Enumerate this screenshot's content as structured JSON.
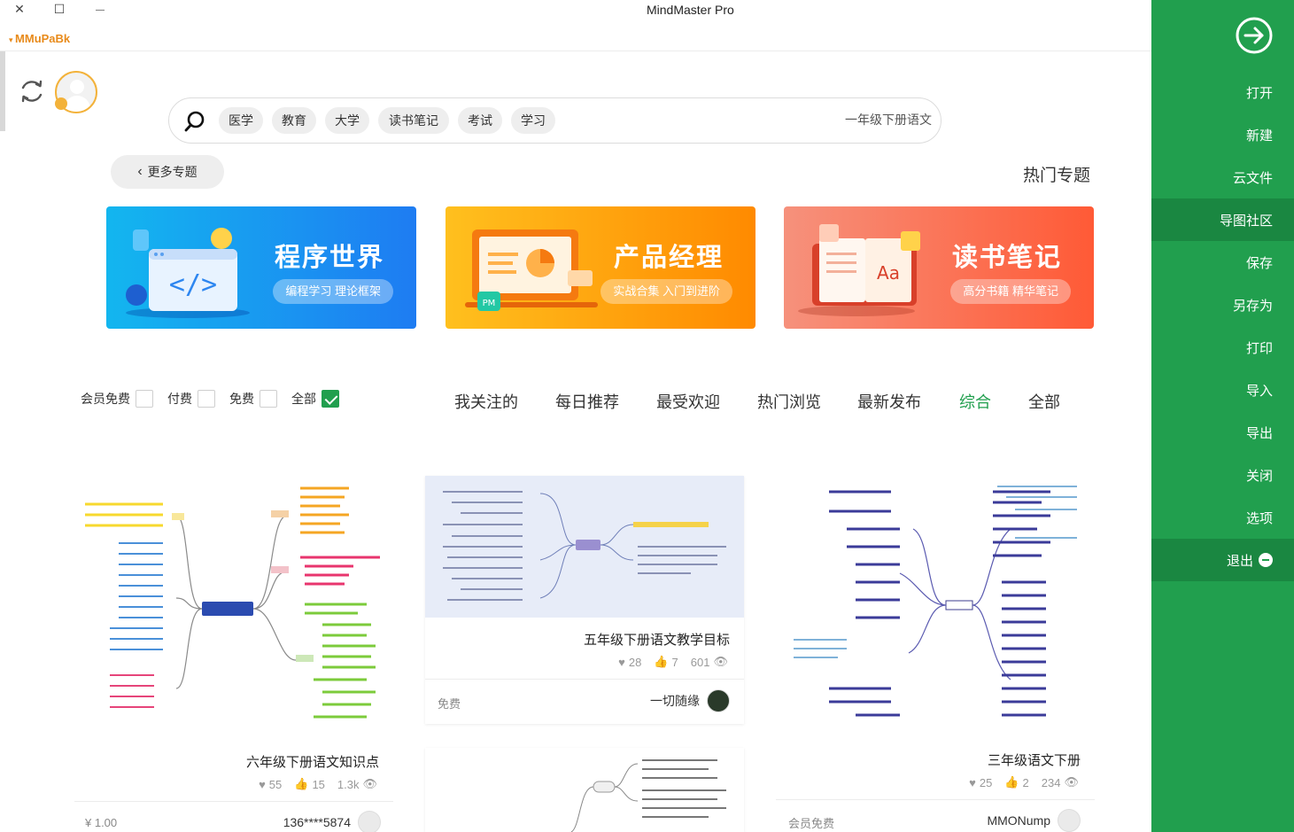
{
  "app": {
    "title": "MindMaster Pro",
    "account": "MMuPaBk",
    "window_controls": {
      "close": "✕",
      "maximize": "☐",
      "minimize": "—"
    }
  },
  "sidebar": {
    "items": [
      {
        "label": "打开"
      },
      {
        "label": "新建"
      },
      {
        "label": "云文件"
      },
      {
        "label": "导图社区"
      },
      {
        "label": "保存"
      },
      {
        "label": "另存为"
      },
      {
        "label": "打印"
      },
      {
        "label": "导入"
      },
      {
        "label": "导出"
      },
      {
        "label": "关闭"
      },
      {
        "label": "选项"
      },
      {
        "label": "退出"
      }
    ],
    "active_item": "导图社区",
    "colors": {
      "background": "#219f4e",
      "active": "#1a8741"
    }
  },
  "search": {
    "value": "一年级下册语文",
    "tags": [
      "学习",
      "考试",
      "读书笔记",
      "大学",
      "教育",
      "医学"
    ]
  },
  "topics": {
    "title": "热门专题",
    "more_button": "更多专题",
    "banners": [
      {
        "title": "读书笔记",
        "subtitle": "高分书籍 精华笔记",
        "color_from": "#ff5a36",
        "color_to": "#f6917c"
      },
      {
        "title": "产品经理",
        "subtitle": "实战合集 入门到进阶",
        "color_from": "#ff8a00",
        "color_to": "#ffc01e"
      },
      {
        "title": "程序世界",
        "subtitle": "编程学习 理论框架",
        "color_from": "#1e7cf2",
        "color_to": "#13b6ef"
      }
    ]
  },
  "tabs": [
    "全部",
    "综合",
    "最新发布",
    "热门浏览",
    "最受欢迎",
    "每日推荐",
    "我关注的"
  ],
  "active_tab": "综合",
  "filters": [
    {
      "label": "全部",
      "checked": true
    },
    {
      "label": "免费",
      "checked": false
    },
    {
      "label": "付费",
      "checked": false
    },
    {
      "label": "会员免费",
      "checked": false
    }
  ],
  "cards": [
    {
      "title": "三年级语文下册",
      "views": "234",
      "likes": "2",
      "favorites": "25",
      "author": "MMONump",
      "price": "会员免费"
    },
    {
      "title": "五年级下册语文教学目标",
      "views": "601",
      "likes": "7",
      "favorites": "28",
      "author": "一切随缘",
      "price": "免费"
    },
    {
      "title": "六年级下册语文知识点",
      "views": "1.3k",
      "likes": "15",
      "favorites": "55",
      "author": "136****5874",
      "price": "¥ 1.00"
    }
  ]
}
